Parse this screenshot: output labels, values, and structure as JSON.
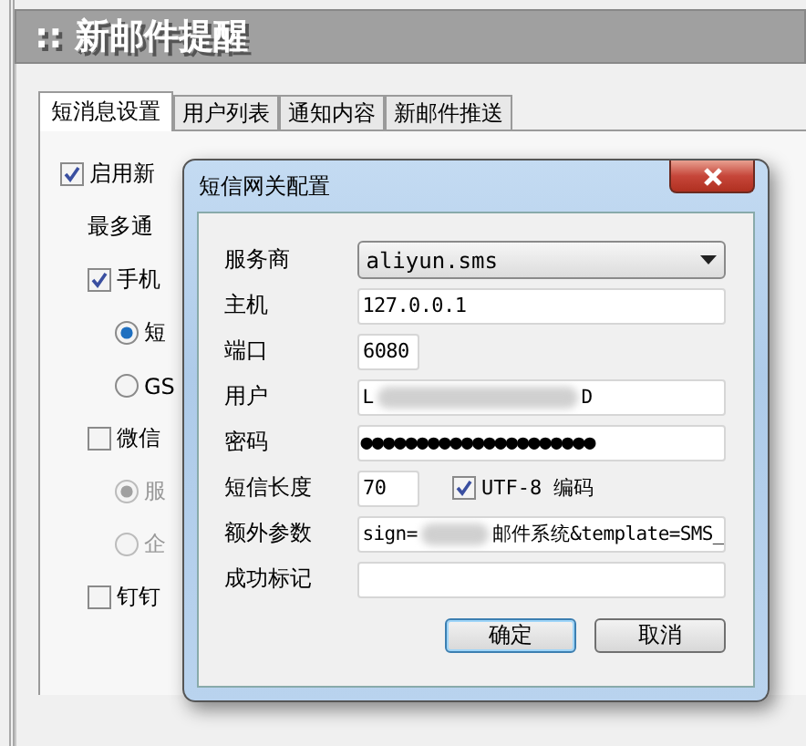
{
  "window": {
    "title": ":: 新邮件提醒"
  },
  "tabs": [
    {
      "label": "短消息设置",
      "selected": true
    },
    {
      "label": "用户列表",
      "selected": false
    },
    {
      "label": "通知内容",
      "selected": false
    },
    {
      "label": "新邮件推送",
      "selected": false
    }
  ],
  "options": [
    {
      "kind": "checkbox",
      "label": "启用新",
      "checked": true,
      "disabled": false,
      "children": [
        {
          "kind": "label",
          "label": "最多通"
        },
        {
          "kind": "checkbox",
          "label": "手机",
          "checked": true,
          "disabled": false,
          "children": [
            {
              "kind": "radio",
              "label": "短",
              "selected": true,
              "disabled": false
            },
            {
              "kind": "radio",
              "label": "GS",
              "selected": false,
              "disabled": false
            }
          ]
        },
        {
          "kind": "checkbox",
          "label": "微信",
          "checked": false,
          "disabled": false,
          "children": [
            {
              "kind": "radio",
              "label": "服",
              "selected": true,
              "disabled": true
            },
            {
              "kind": "radio",
              "label": "企",
              "selected": false,
              "disabled": true
            }
          ]
        },
        {
          "kind": "checkbox",
          "label": "钉钉",
          "checked": false,
          "disabled": false
        }
      ]
    }
  ],
  "dialog": {
    "title": "短信网关配置",
    "fields": [
      {
        "kind": "select",
        "label": "服务商",
        "value": "aliyun.sms"
      },
      {
        "kind": "text",
        "label": "主机",
        "value": "127.0.0.1"
      },
      {
        "kind": "short-text",
        "label": "端口",
        "value": "6080"
      },
      {
        "kind": "redacted-text",
        "label": "用户",
        "value_start": "L",
        "value_end": "D"
      },
      {
        "kind": "text",
        "label": "密码",
        "value": "●●●●●●●●●●●●●●●●●●●●●"
      },
      {
        "kind": "short-text",
        "label": "短信长度",
        "value": "70",
        "checkbox": {
          "label": "UTF-8 编码",
          "checked": true
        }
      },
      {
        "kind": "redacted-text",
        "label": "额外参数",
        "value_start": "sign=",
        "value_end": "邮件系统&template=SMS_"
      },
      {
        "kind": "text",
        "label": "成功标记"
      }
    ],
    "buttons": [
      {
        "label": "确定",
        "default": true
      },
      {
        "label": "取消",
        "default": false
      }
    ]
  }
}
